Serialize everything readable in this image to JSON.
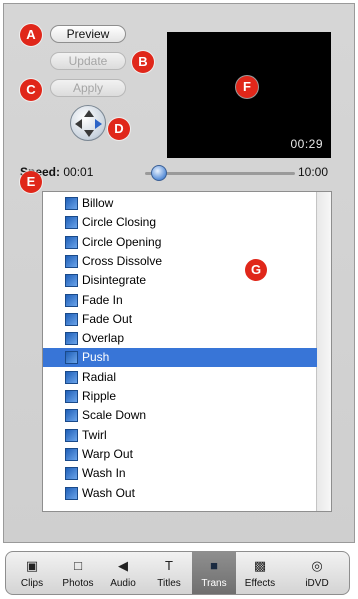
{
  "controls": {
    "preview_label": "Preview",
    "update_label": "Update",
    "apply_label": "Apply"
  },
  "viewer": {
    "timecode": "00:29"
  },
  "speed": {
    "label": "Speed:",
    "min_label": "00:01",
    "max_label": "10:00",
    "value_fraction": 0.05
  },
  "transitions": {
    "selected": "Push",
    "items": [
      "Billow",
      "Circle Closing",
      "Circle Opening",
      "Cross Dissolve",
      "Disintegrate",
      "Fade In",
      "Fade Out",
      "Overlap",
      "Push",
      "Radial",
      "Ripple",
      "Scale Down",
      "Twirl",
      "Warp Out",
      "Wash In",
      "Wash Out"
    ]
  },
  "callouts": [
    "A",
    "B",
    "C",
    "D",
    "E",
    "F",
    "G"
  ],
  "tabs": [
    {
      "label": "Clips",
      "icon": "clips-icon"
    },
    {
      "label": "Photos",
      "icon": "photos-icon"
    },
    {
      "label": "Audio",
      "icon": "audio-icon"
    },
    {
      "label": "Titles",
      "icon": "titles-icon"
    },
    {
      "label": "Trans",
      "icon": "trans-icon",
      "active": true
    },
    {
      "label": "Effects",
      "icon": "effects-icon"
    },
    {
      "label": "iDVD",
      "icon": "idvd-icon"
    }
  ],
  "colors": {
    "callout": "#e0271a",
    "selection": "#3875d7",
    "viewer_bg": "#000000"
  }
}
